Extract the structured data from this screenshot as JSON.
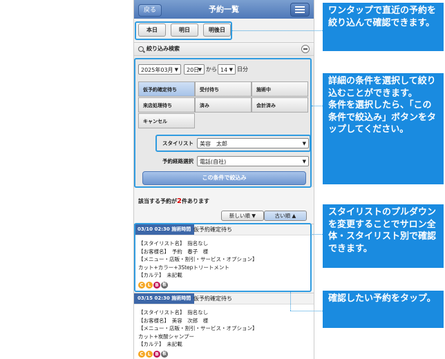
{
  "header": {
    "back_label": "戻る",
    "title": "予約一覧"
  },
  "date_buttons": [
    "本日",
    "明日",
    "明後日"
  ],
  "filter": {
    "title": "絞り込み検索",
    "year_month": "2025年03月",
    "start_day": "20日",
    "from_text": "から",
    "days": "14",
    "days_unit": "日分",
    "status_options": [
      "仮予約確定待ち",
      "受付待ち",
      "施術中",
      "来店処理待ち",
      "済み",
      "会計済み",
      "キャンセル"
    ],
    "stylist_label": "スタイリスト",
    "stylist_value": "美容　太郎",
    "channel_label": "予約経路選択",
    "channel_value": "電話(自社)",
    "apply_label": "この条件で絞込み"
  },
  "result_count": {
    "prefix": "該当する予約が",
    "count": "2",
    "suffix": "件あります"
  },
  "sort": {
    "newest": "新しい順 ▼",
    "oldest": "古い順 ▲"
  },
  "reservations": [
    {
      "time": "03/10 02:30 施術時間",
      "status": "仮予約確定待ち",
      "lines": [
        "【スタイリスト名】　指名なし",
        "【お客様名】　予約　春子　様",
        "【メニュー・店販・割引・サービス・オプション】",
        "カット+カラー+3Stepトリートメント",
        "【カルテ】　未記載"
      ]
    },
    {
      "time": "03/15 02:30 施術時間",
      "status": "仮予約確定待ち",
      "lines": [
        "【スタイリスト名】　指名なし",
        "【お客様名】　美容　次郎　様",
        "【メニュー・店販・割引・サービス・オプション】",
        "カット+炭酸シャンプー",
        "【カルテ】　未記載"
      ]
    }
  ],
  "badges": [
    "C",
    "L",
    "B",
    "板"
  ],
  "callouts": [
    "ワンタップで直近の予約を絞り込んで確認できます。",
    "詳細の条件を選択して絞り込むことができます。\n条件を選択したら、「この条件で絞込み」ボタンをタップしてください。",
    "スタイリストのプルダウンを変更することでサロン全体・スタイリスト別で確認できます。",
    "確認したい予約をタップ。"
  ]
}
